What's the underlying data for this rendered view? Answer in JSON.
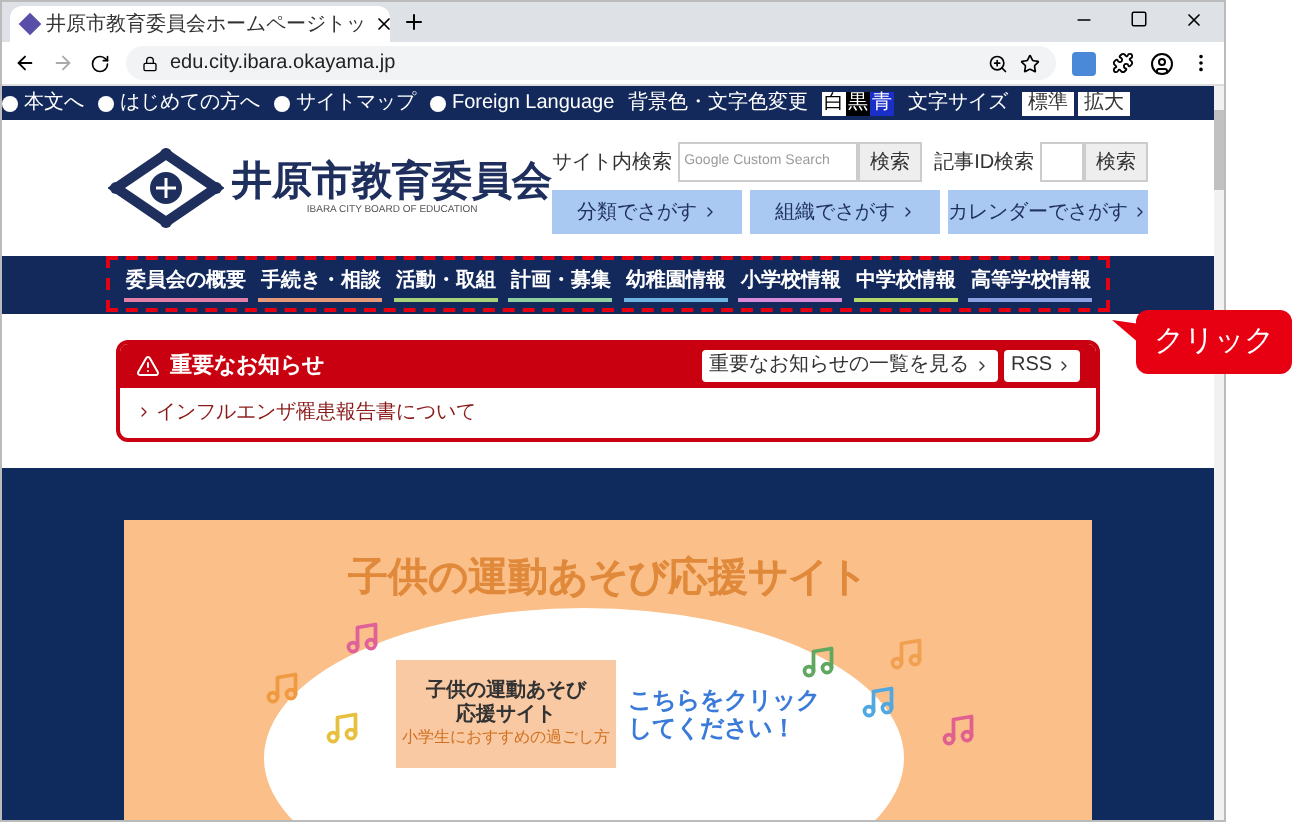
{
  "browser": {
    "tab_title": "井原市教育委員会ホームページトッ",
    "url": "edu.city.ibara.okayama.jp"
  },
  "top_bar": {
    "links": [
      "本文へ",
      "はじめての方へ",
      "サイトマップ",
      "Foreign Language"
    ],
    "color_label": "背景色・文字色変更",
    "color_options": [
      {
        "label": "白",
        "color": "#ffffff"
      },
      {
        "label": "黒",
        "color": "#000000"
      },
      {
        "label": "青",
        "color": "#1a2fc8"
      }
    ],
    "size_label": "文字サイズ",
    "size_options": [
      "標準",
      "拡大"
    ]
  },
  "header": {
    "title": "井原市教育委員会",
    "subtitle": "IBARA CITY BOARD OF EDUCATION",
    "site_search": {
      "label": "サイト内検索",
      "placeholder": "Google Custom Search",
      "button": "検索"
    },
    "id_search": {
      "label": "記事ID検索",
      "button": "検索"
    },
    "find_buttons": [
      "分類でさがす",
      "組織でさがす",
      "カレンダーでさがす"
    ]
  },
  "nav": {
    "items": [
      {
        "label": "委員会の概要",
        "color": "#e27fa6"
      },
      {
        "label": "手続き・相談",
        "color": "#e69a7a"
      },
      {
        "label": "活動・取組",
        "color": "#a5d27a"
      },
      {
        "label": "計画・募集",
        "color": "#8fd0a0"
      },
      {
        "label": "幼稚園情報",
        "color": "#6fb4e0"
      },
      {
        "label": "小学校情報",
        "color": "#d68ad8"
      },
      {
        "label": "中学校情報",
        "color": "#b6d86a"
      },
      {
        "label": "高等学校情報",
        "color": "#8aa0e0"
      }
    ]
  },
  "notice": {
    "title": "重要なお知らせ",
    "buttons": [
      "重要なお知らせの一覧を見る",
      "RSS"
    ],
    "items": [
      "インフルエンザ罹患報告書について"
    ]
  },
  "banner": {
    "title": "子供の運動あそび応援サイト",
    "card_title": [
      "子供の運動あそび",
      "応援サイト"
    ],
    "card_subtitle": "小学生におすすめの過ごし方",
    "cta": [
      "こちらをクリック",
      "してください！"
    ]
  },
  "callout": "クリック"
}
